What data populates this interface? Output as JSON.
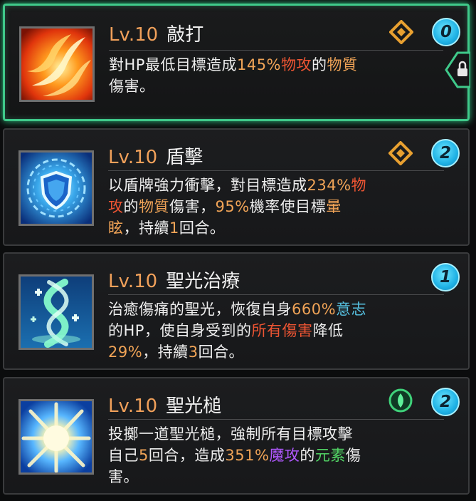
{
  "skills": [
    {
      "level": "Lv.10",
      "name": "敲打",
      "count": "0",
      "type_icon": "physical-diamond-icon",
      "desc": {
        "l1_a": "對HP最低目標造成",
        "l1_pct": "145%",
        "l1_atk": "物攻",
        "l1_of": "的",
        "l1_type": "物質",
        "l2": "傷害。"
      }
    },
    {
      "level": "Lv.10",
      "name": "盾擊",
      "count": "2",
      "type_icon": "physical-diamond-icon",
      "desc": {
        "l1_a": "以盾牌強力衝擊，對目標造成",
        "l1_pct": "234%",
        "l1_atk1": "物",
        "l2_atk2": "攻",
        "l2_of": "的",
        "l2_type": "物質",
        "l2_b": "傷害，",
        "l2_rate": "95%",
        "l2_c": "機率使目標",
        "l2_stun1": "暈",
        "l3_stun2": "眩",
        "l3_a": "，持續",
        "l3_n": "1",
        "l3_b": "回合。"
      }
    },
    {
      "level": "Lv.10",
      "name": "聖光治療",
      "count": "1",
      "desc": {
        "l1_a": "治癒傷痛的聖光，恢復自身",
        "l1_pct": "660%",
        "l1_stat": "意志",
        "l2_a": "的HP，使自身受到的",
        "l2_dmg": "所有傷害",
        "l2_b": "降低",
        "l3_pct": "29%",
        "l3_a": "，持續",
        "l3_n": "3",
        "l3_b": "回合。"
      }
    },
    {
      "level": "Lv.10",
      "name": "聖光槌",
      "count": "2",
      "type_icon": "element-drop-icon",
      "desc": {
        "l1": "投擲一道聖光槌，強制所有目標攻擊",
        "l2_a": "自己",
        "l2_n": "5",
        "l2_b": "回合，造成",
        "l2_pct": "351%",
        "l2_atk": "魔攻",
        "l2_of": "的",
        "l2_type": "元素",
        "l2_c": "傷",
        "l3": "害。"
      }
    }
  ],
  "colors": {
    "active_border": "#3fc98a",
    "level": "#f0a05a",
    "percent": "#f1a457",
    "damage": "#ef5533",
    "stat": "#57c3e3",
    "magic": "#b058ff",
    "element": "#52d465",
    "badge": "#1fb2e5"
  }
}
